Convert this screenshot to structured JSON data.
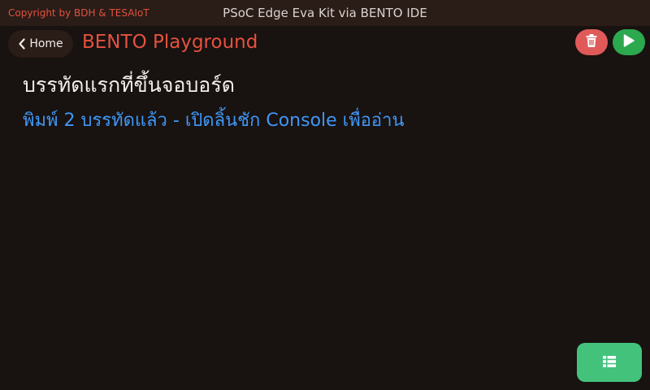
{
  "topbar": {
    "copyright": "Copyright by BDH & TESAIoT",
    "title": "PSoC Edge Eva Kit via BENTO IDE"
  },
  "header": {
    "home_label": "Home",
    "app_title": "BENTO Playground"
  },
  "content": {
    "line1": "บรรทัดแรกที่ขึ้นจอบอร์ด",
    "line2": "พิมพ์ 2 บรรทัดแล้ว - เปิดลิ้นชัก Console เพื่ออ่าน"
  },
  "icons": {
    "back": "chevron-left-icon",
    "delete": "trash-icon",
    "run": "play-icon",
    "console": "list-icon"
  },
  "colors": {
    "background": "#181210",
    "topbar": "#2a1c17",
    "accent_red": "#e65140",
    "delete_button": "#e05a5a",
    "run_button": "#2ca84f",
    "console_button": "#43c27c",
    "info_text": "#3f97f6"
  }
}
